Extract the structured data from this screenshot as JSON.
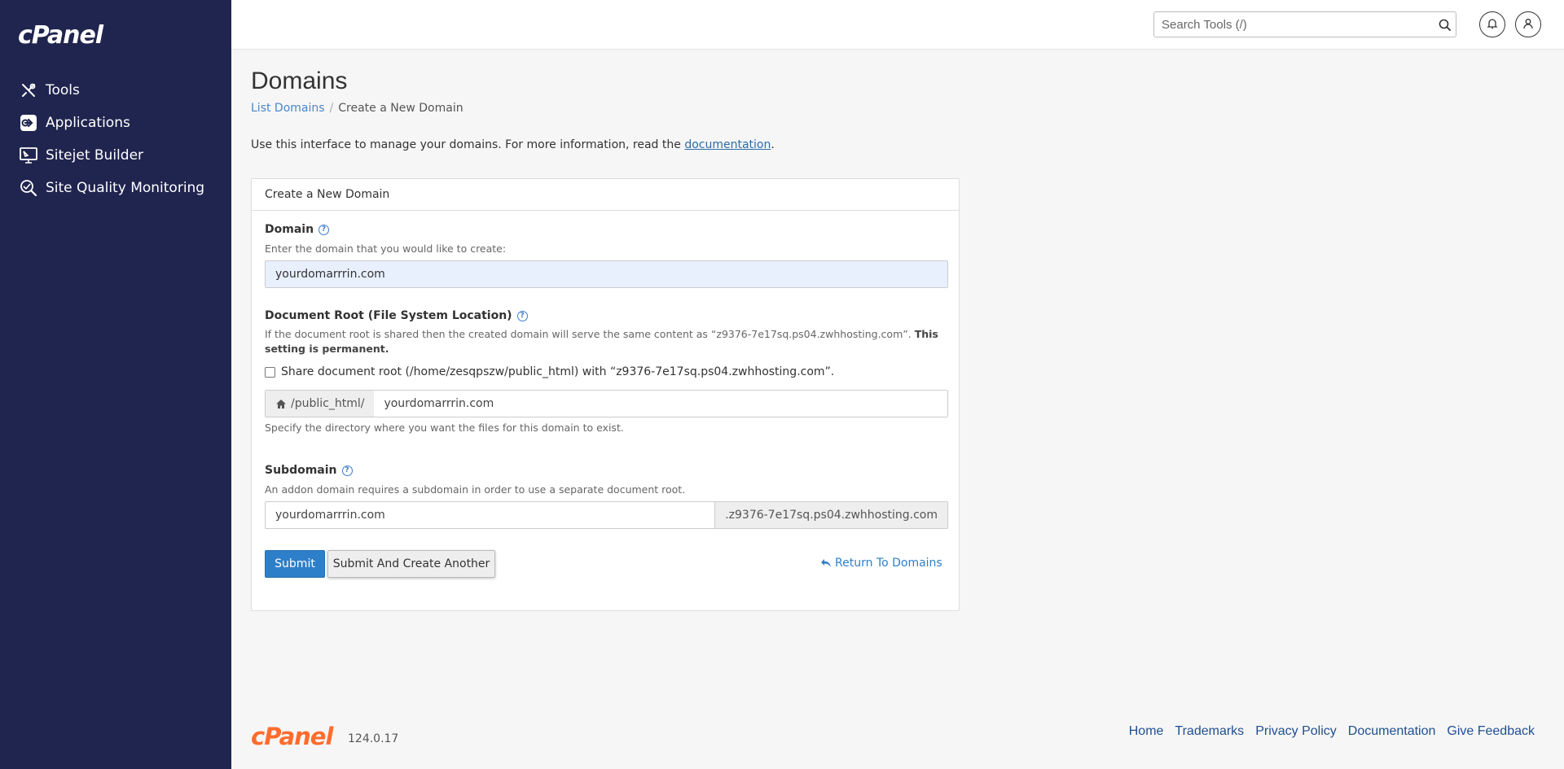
{
  "brand": {
    "logo_text": "cPanel",
    "version": "124.0.17"
  },
  "sidebar": {
    "items": [
      {
        "label": "Tools",
        "icon": "tools-icon"
      },
      {
        "label": "Applications",
        "icon": "applications-icon"
      },
      {
        "label": "Sitejet Builder",
        "icon": "sitejet-icon"
      },
      {
        "label": "Site Quality Monitoring",
        "icon": "site-quality-icon"
      }
    ]
  },
  "header": {
    "search_placeholder": "Search Tools (/)"
  },
  "page": {
    "title": "Domains",
    "breadcrumb": {
      "link": "List Domains",
      "current": "Create a New Domain"
    },
    "intro_text": "Use this interface to manage your domains. For more information, read the ",
    "intro_link": "documentation",
    "intro_end": "."
  },
  "form": {
    "heading": "Create a New Domain",
    "domain": {
      "label": "Domain",
      "hint": "Enter the domain that you would like to create:",
      "value": "yourdomarrrin.com"
    },
    "docroot": {
      "label": "Document Root (File System Location)",
      "desc": "If the document root is shared then the created domain will serve the same content as “z9376-7e17sq.ps04.zwhhosting.com”. ",
      "desc_bold": "This setting is permanent.",
      "share_label": "Share document root (/home/zesqpszw/public_html) with “z9376-7e17sq.ps04.zwhhosting.com”.",
      "share_checked": false,
      "prefix": "/public_html/",
      "value": "yourdomarrrin.com",
      "hint": "Specify the directory where you want the files for this domain to exist."
    },
    "subdomain": {
      "label": "Subdomain",
      "hint": "An addon domain requires a subdomain in order to use a separate document root.",
      "value": "yourdomarrrin.com",
      "suffix": ".z9376-7e17sq.ps04.zwhhosting.com"
    },
    "buttons": {
      "submit": "Submit",
      "submit_another": "Submit And Create Another",
      "return": "Return To Domains"
    }
  },
  "footer": {
    "links": [
      "Home",
      "Trademarks",
      "Privacy Policy",
      "Documentation",
      "Give Feedback"
    ]
  },
  "colors": {
    "sidebar_bg": "#20254f",
    "accent": "#2e7fc9",
    "footer_logo": "#ff6c2c",
    "domain_input_bg": "#e8f0fe"
  }
}
